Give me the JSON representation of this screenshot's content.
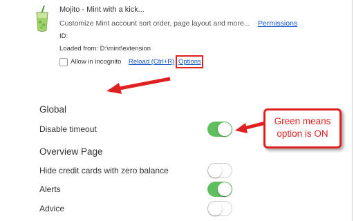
{
  "extension": {
    "title": "Mojito - Mint with a kick...",
    "description": "Customize Mint account sort order, page layout and more...",
    "permissions_link": "Permissions",
    "id_label": "ID:",
    "loaded_from": "Loaded from: D:\\mint\\extension",
    "incognito_label": "Allow in incognito",
    "incognito_checked": false,
    "reload_link": "Reload (Ctrl+R)",
    "options_link": "Options",
    "icon": "mojito-glass-icon"
  },
  "sections": {
    "global": {
      "heading": "Global",
      "settings": [
        {
          "label": "Disable timeout",
          "on": true
        }
      ]
    },
    "overview": {
      "heading": "Overview Page",
      "settings": [
        {
          "label": "Hide credit cards with zero balance",
          "on": false
        },
        {
          "label": "Alerts",
          "on": true
        },
        {
          "label": "Advice",
          "on": false
        }
      ]
    }
  },
  "callout": {
    "line1": "Green means",
    "line2": "option is ON"
  },
  "colors": {
    "toggle_on": "#5fbf5f",
    "annotation_red": "#e02020",
    "link_blue": "#1155cc"
  }
}
